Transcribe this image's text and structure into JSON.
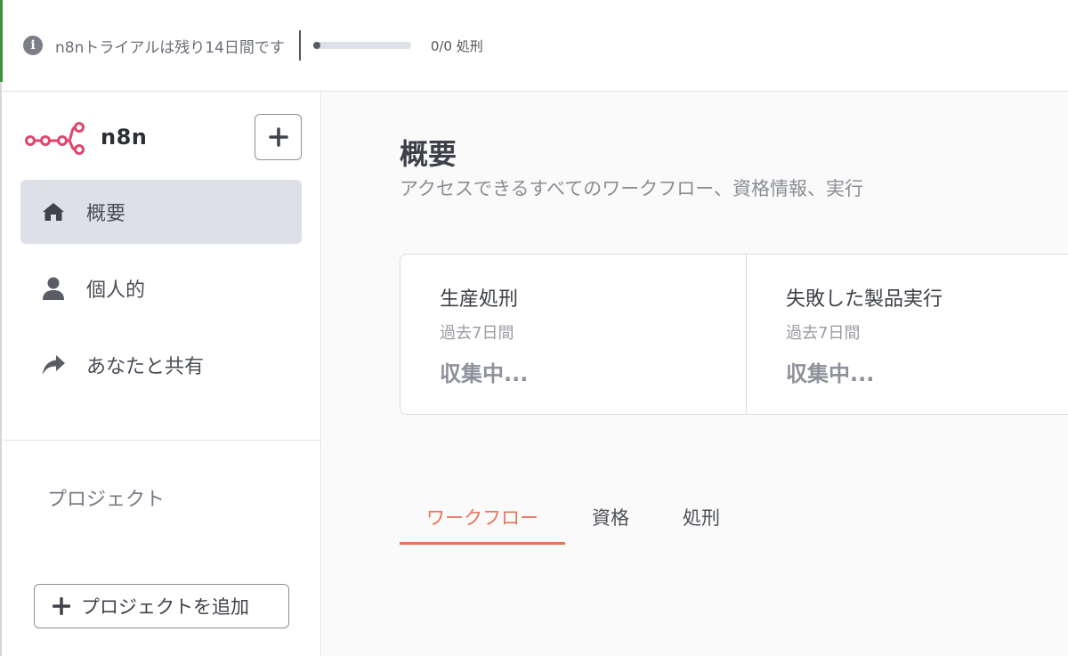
{
  "banner": {
    "trial_text": "n8nトライアルは残り14日間です",
    "progress_text": "0/0 処刑",
    "progress_fraction": 0.0
  },
  "brand": {
    "name": "n8n",
    "accent": "#e0466b"
  },
  "sidebar": {
    "items": [
      {
        "label": "概要",
        "icon": "home-icon",
        "active": true
      },
      {
        "label": "個人的",
        "icon": "user-icon",
        "active": false
      },
      {
        "label": "あなたと共有",
        "icon": "share-icon",
        "active": false
      }
    ],
    "projects_label": "プロジェクト",
    "add_project_label": "プロジェクトを追加"
  },
  "main": {
    "title": "概要",
    "subtitle": "アクセスできるすべてのワークフロー、資格情報、実行",
    "stats": [
      {
        "title": "生産処刑",
        "period": "過去7日間",
        "value": "収集中..."
      },
      {
        "title": "失敗した製品実行",
        "period": "過去7日間",
        "value": "収集中..."
      }
    ],
    "tabs": [
      {
        "label": "ワークフロー",
        "active": true
      },
      {
        "label": "資格",
        "active": false
      },
      {
        "label": "処刑",
        "active": false
      }
    ],
    "accent_color": "#e8745a"
  }
}
